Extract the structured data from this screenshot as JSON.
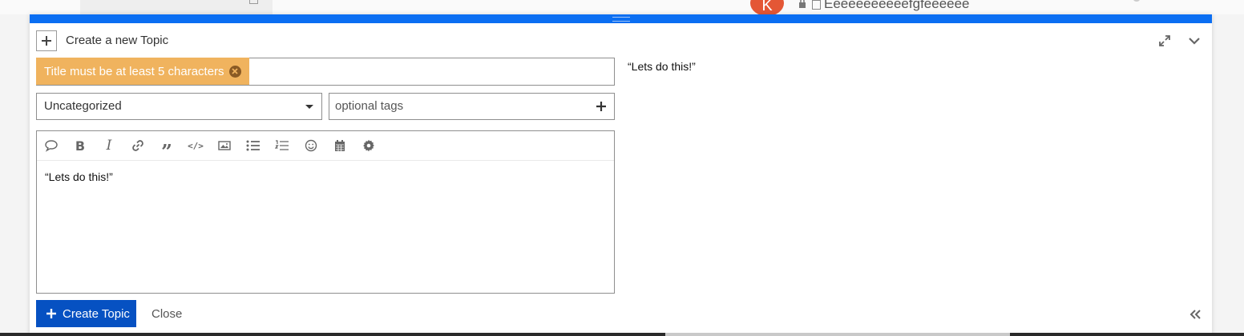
{
  "background": {
    "avatar_letter": "K",
    "topic_title": "Eeeeeeeeeeefgfeeeeee"
  },
  "composer": {
    "header_title": "Create a new Topic",
    "title_error": "Title must be at least 5 characters",
    "category": "Uncategorized",
    "tags_placeholder": "optional tags",
    "toolbar": [
      "speech-bubble-icon",
      "bold-icon",
      "italic-icon",
      "link-icon",
      "quote-icon",
      "code-icon",
      "image-icon",
      "bulleted-list-icon",
      "numbered-list-icon",
      "emoji-icon",
      "calendar-icon",
      "gear-icon"
    ],
    "bold_glyph": "B",
    "italic_glyph": "I",
    "quote_glyph": "”",
    "code_glyph": "</>",
    "body_text": "“Lets do this!”",
    "preview_text": "“Lets do this!”",
    "create_button": "Create Topic",
    "close_button": "Close"
  },
  "colors": {
    "accent": "#0a6ef2",
    "primary_button": "#0651c2",
    "error_tooltip": "#f0b35e",
    "avatar": "#e45735"
  }
}
